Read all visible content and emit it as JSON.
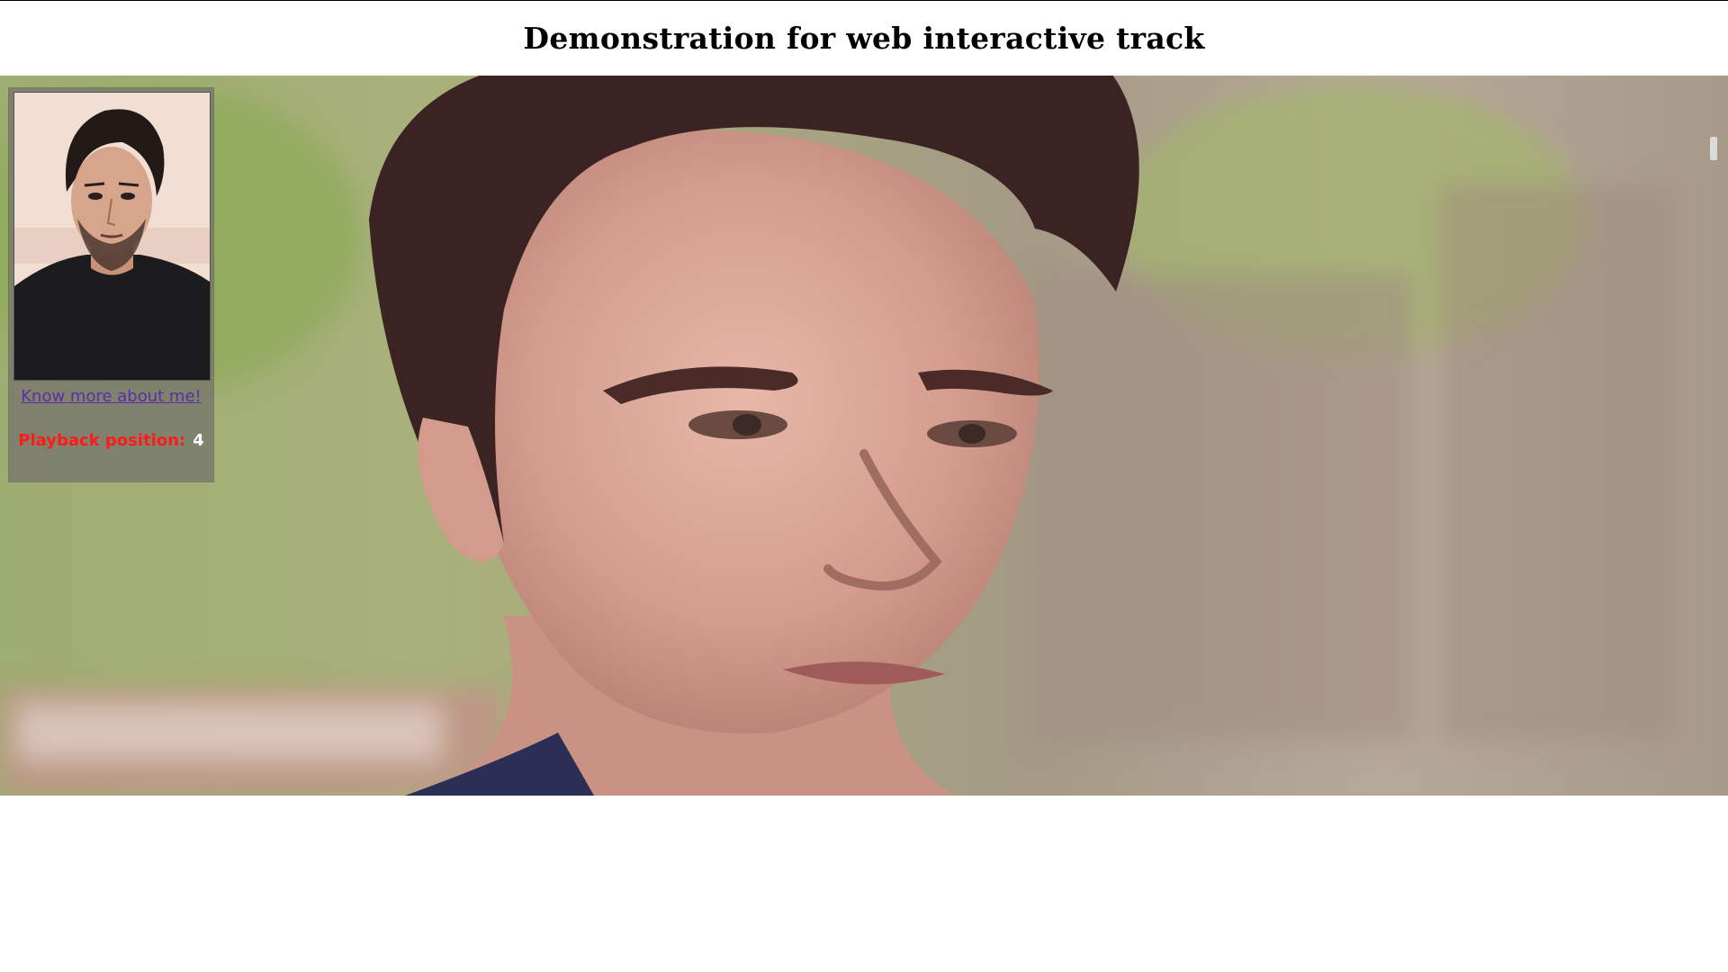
{
  "page": {
    "title": "Demonstration for web interactive track"
  },
  "overlay": {
    "link_text": "Know more about me!",
    "playback_label": "Playback position:",
    "playback_value": "4"
  },
  "colors": {
    "link": "#5b2ea6",
    "playback_label": "#ff1a1a",
    "playback_value": "#ffffff",
    "overlay_bg": "#78786c"
  },
  "icons": {
    "portrait": "person-portrait-image",
    "video": "video-frame-image"
  }
}
